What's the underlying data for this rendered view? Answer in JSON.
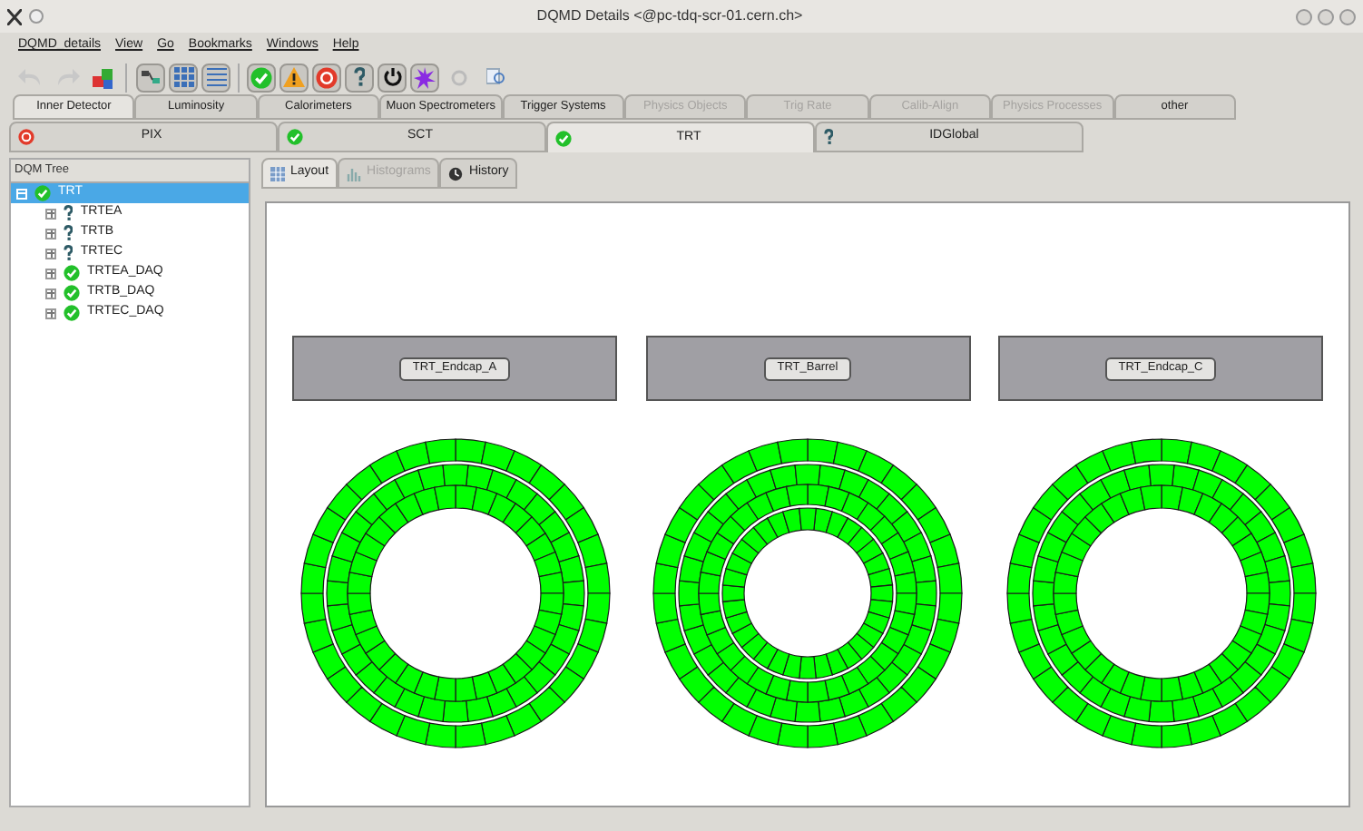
{
  "window": {
    "title": "DQMD Details <@pc-tdq-scr-01.cern.ch>"
  },
  "menu": [
    "DQMD_details",
    "View",
    "Go",
    "Bookmarks",
    "Windows",
    "Help"
  ],
  "categories": [
    {
      "label": "Inner Detector",
      "selected": true,
      "disabled": false
    },
    {
      "label": "Luminosity",
      "selected": false,
      "disabled": false
    },
    {
      "label": "Calorimeters",
      "selected": false,
      "disabled": false
    },
    {
      "label": "Muon Spectrometers",
      "selected": false,
      "disabled": false
    },
    {
      "label": "Trigger Systems",
      "selected": false,
      "disabled": false
    },
    {
      "label": "Physics Objects",
      "selected": false,
      "disabled": true
    },
    {
      "label": "Trig Rate",
      "selected": false,
      "disabled": true
    },
    {
      "label": "Calib-Align",
      "selected": false,
      "disabled": true
    },
    {
      "label": "Physics Processes",
      "selected": false,
      "disabled": true
    },
    {
      "label": "other",
      "selected": false,
      "disabled": false
    }
  ],
  "subsystems": [
    {
      "label": "PIX",
      "kind": "error",
      "selected": false
    },
    {
      "label": "SCT",
      "kind": "ok",
      "selected": false
    },
    {
      "label": "TRT",
      "kind": "ok",
      "selected": true
    },
    {
      "label": "IDGlobal",
      "kind": "unknown",
      "selected": false
    }
  ],
  "tree": {
    "header": "DQM Tree",
    "items": [
      {
        "label": "TRT",
        "kind": "ok",
        "expanded": true,
        "selected": true,
        "children": [
          {
            "label": "TRTEA",
            "kind": "unknown",
            "expanded": false,
            "selected": false
          },
          {
            "label": "TRTB",
            "kind": "unknown",
            "expanded": false,
            "selected": false
          },
          {
            "label": "TRTEC",
            "kind": "unknown",
            "expanded": false,
            "selected": false
          },
          {
            "label": "TRTEA_DAQ",
            "kind": "ok",
            "expanded": false,
            "selected": false
          },
          {
            "label": "TRTB_DAQ",
            "kind": "ok",
            "expanded": false,
            "selected": false
          },
          {
            "label": "TRTEC_DAQ",
            "kind": "ok",
            "expanded": false,
            "selected": false
          }
        ]
      }
    ]
  },
  "views": [
    {
      "label": "Layout",
      "selected": true,
      "disabled": false
    },
    {
      "label": "Histograms",
      "selected": false,
      "disabled": true
    },
    {
      "label": "History",
      "selected": false,
      "disabled": false
    }
  ],
  "detectors": [
    {
      "label": "TRT_Endcap_A",
      "kind": "endcap",
      "color": "#00ff00"
    },
    {
      "label": "TRT_Barrel",
      "kind": "barrel",
      "color": "#00ff00"
    },
    {
      "label": "TRT_Endcap_C",
      "kind": "endcap",
      "color": "#00ff00"
    }
  ]
}
